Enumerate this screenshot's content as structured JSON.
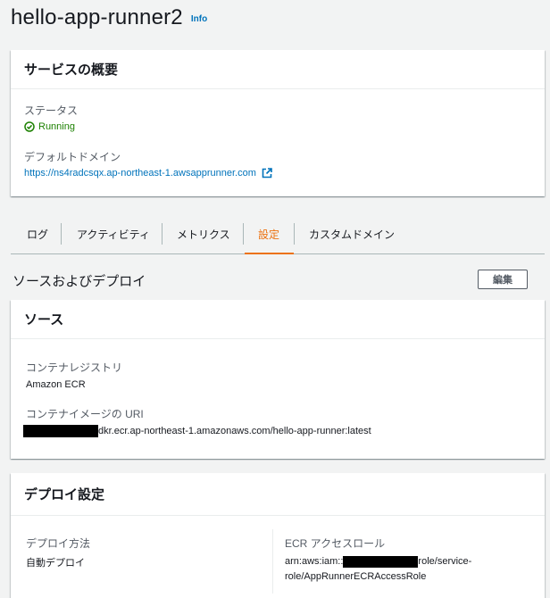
{
  "header": {
    "title": "hello-app-runner2",
    "info_label": "Info"
  },
  "overview": {
    "heading": "サービスの概要",
    "status_label": "ステータス",
    "status_value": "Running",
    "domain_label": "デフォルトドメイン",
    "domain_value": "https://ns4radcsqx.ap-northeast-1.awsapprunner.com"
  },
  "tabs": [
    {
      "label": "ログ",
      "active": false
    },
    {
      "label": "アクティビティ",
      "active": false
    },
    {
      "label": "メトリクス",
      "active": false
    },
    {
      "label": "設定",
      "active": true
    },
    {
      "label": "カスタムドメイン",
      "active": false
    }
  ],
  "source_deploy": {
    "title": "ソースおよびデプロイ",
    "edit_label": "編集"
  },
  "source": {
    "heading": "ソース",
    "registry_label": "コンテナレジストリ",
    "registry_value": "Amazon ECR",
    "uri_label": "コンテナイメージの URI",
    "uri_suffix": "dkr.ecr.ap-northeast-1.amazonaws.com/hello-app-runner:latest"
  },
  "deploy": {
    "heading": "デプロイ設定",
    "method_label": "デプロイ方法",
    "method_value": "自動デプロイ",
    "role_label": "ECR アクセスロール",
    "role_prefix": "arn:aws:iam::",
    "role_suffix_1": "role/service-",
    "role_line2": "role/AppRunnerECRAccessRole"
  },
  "colors": {
    "accent": "#ec7211",
    "link": "#0073bb",
    "success": "#1d8102",
    "background": "#f2f3f3"
  },
  "icons": {
    "status": "check-circle-icon",
    "external": "external-link-icon"
  }
}
